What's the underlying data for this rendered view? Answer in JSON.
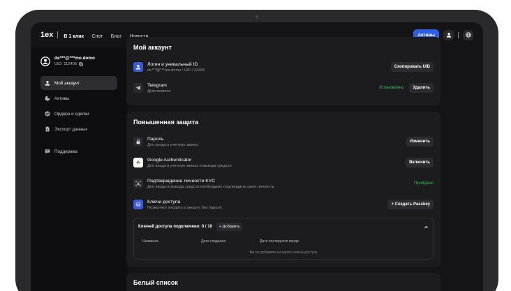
{
  "header": {
    "logo": "1ex",
    "nav": [
      "В 1 клик",
      "Спот",
      "Блог",
      "Новости"
    ],
    "assets_button": "Активы"
  },
  "sidebar": {
    "email": "de***@***mo.demo",
    "uid": "UID: 112405",
    "items": [
      {
        "label": "Мой аккаунт",
        "icon": "user-icon",
        "active": true
      },
      {
        "label": "Активы",
        "icon": "pie-icon",
        "active": false
      },
      {
        "label": "Ордера и сделки",
        "icon": "swap-icon",
        "active": false
      },
      {
        "label": "Экспорт данных",
        "icon": "file-icon",
        "active": false
      },
      {
        "label": "Поддержка",
        "icon": "chat-icon",
        "active": false
      }
    ]
  },
  "account": {
    "title": "Мой аккаунт",
    "login_title": "Логин и уникальный ID",
    "login_sub": "de***@***mo.demo  \\  UID 112405",
    "copy_btn": "Скопировать UID",
    "telegram_title": "Telegram",
    "telegram_sub": "@demodemo",
    "telegram_status": "Установлено",
    "delete_btn": "Удалить"
  },
  "security": {
    "title": "Повышенная защита",
    "password_title": "Пароль",
    "password_sub": "Для входа в учетную запись",
    "change_btn": "Изменить",
    "ga_title": "Google Authenticator",
    "ga_sub": "Для входа в учетную запись и вывода средств",
    "enable_btn": "Включить",
    "kyc_title": "Подтверждение личности KYC",
    "kyc_sub": "Для ввода и вывода средств необходимо подтвердить свою личность",
    "kyc_status": "Пройдено",
    "keys_title": "Ключи доступа",
    "keys_sub": "Позволяют входить в аккаунт без пароля",
    "create_passkey": "+  Создать Passkey",
    "keys_connected": "Ключей доступа подключено: 0 / 10",
    "add_btn": "+  Добавить",
    "col_name": "Название",
    "col_created": "Дата создания",
    "col_last": "Дата последнего входа",
    "empty": "Вы не добавили ни одного ключа доступа"
  },
  "whitelist": {
    "title": "Белый список"
  },
  "colors": {
    "accent": "#2f5fe0",
    "success": "#33c15c"
  }
}
